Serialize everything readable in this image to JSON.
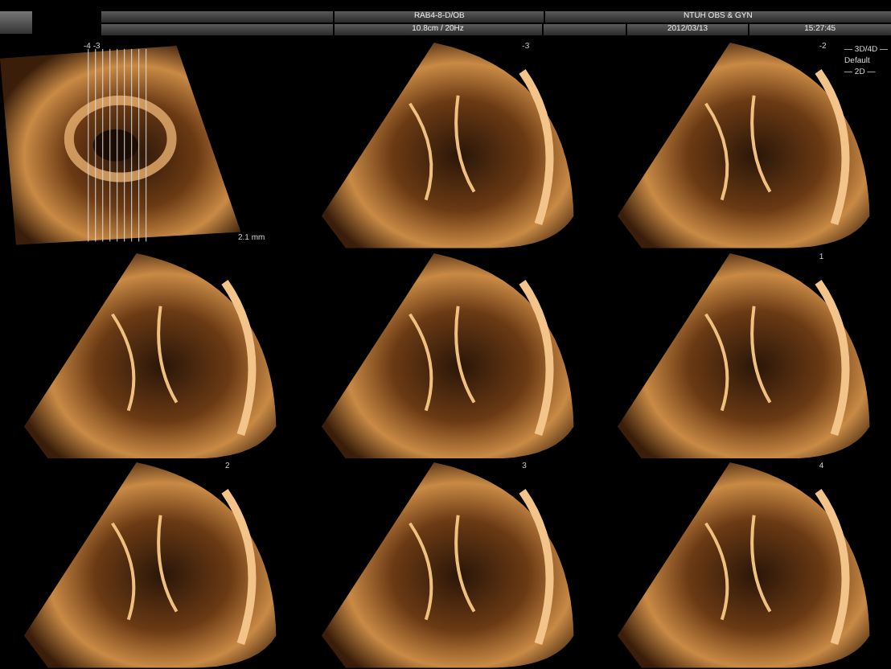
{
  "header": {
    "row_1": [
      {
        "kind": "blank"
      },
      {
        "kind": "field",
        "text": "RAB4-8-D/OB"
      },
      {
        "kind": "field",
        "text": "NTUH OBS & GYN"
      }
    ],
    "row_2": [
      {
        "kind": "blank"
      },
      {
        "kind": "field",
        "text": "10.8cm / 20Hz"
      },
      {
        "kind": "blank"
      },
      {
        "kind": "field",
        "text": "2012/03/13"
      },
      {
        "kind": "field",
        "text": "15:27:45"
      }
    ]
  },
  "tiles": [
    {
      "kind": "reference",
      "label": "-4 -3",
      "scale": "2.1 mm"
    },
    {
      "kind": "slice",
      "label": "-3"
    },
    {
      "kind": "slice",
      "label": "-2"
    },
    {
      "kind": "slice"
    },
    {
      "kind": "slice"
    },
    {
      "kind": "slice",
      "label": "1"
    },
    {
      "kind": "slice",
      "label": "2"
    },
    {
      "kind": "slice",
      "label": "3"
    },
    {
      "kind": "slice",
      "label": "4"
    }
  ],
  "info_panel": [
    "— 3D/4D —",
    "Default",
    "— 2D —"
  ]
}
